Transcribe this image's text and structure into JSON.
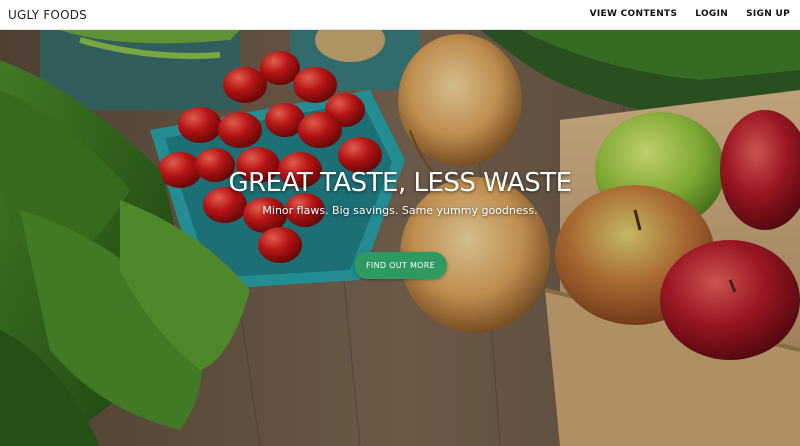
{
  "navbar": {
    "brand": "UGLY FOODS",
    "links": [
      "VIEW CONTENTS",
      "LOGIN",
      "SIGN UP"
    ]
  },
  "hero": {
    "title": "GREAT TASTE, LESS WASTE",
    "subtitle": "Minor flaws. Big savings. Same yummy goodness.",
    "cta_label": "FIND OUT MORE",
    "background_image": "produce-on-wooden-table"
  },
  "colors": {
    "cta": "#2e9a62",
    "navbar_bg": "#ffffff",
    "text_light": "#ffffff"
  }
}
